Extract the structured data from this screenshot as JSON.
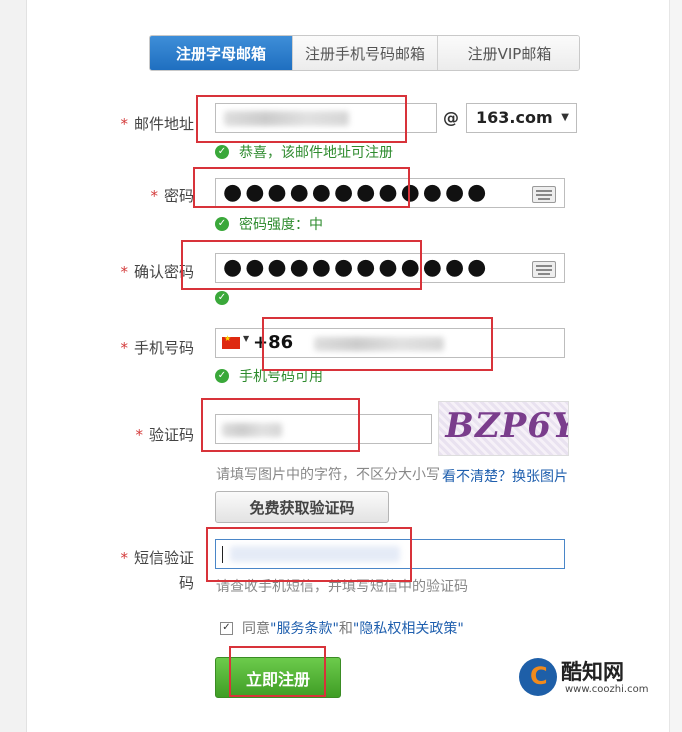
{
  "tabs": [
    "注册字母邮箱",
    "注册手机号码邮箱",
    "注册VIP邮箱"
  ],
  "required_mark": "*",
  "email": {
    "label": "邮件地址",
    "at_sign": "@",
    "domain_selected": "163.com",
    "hint": "恭喜，该邮件地址可注册"
  },
  "password": {
    "label": "密码",
    "value_mask": "●●●●●●●●●●●●",
    "hint": "密码强度：中"
  },
  "confirm_password": {
    "label": "确认密码",
    "value_mask": "●●●●●●●●●●●●"
  },
  "phone": {
    "label": "手机号码",
    "country_code": "+86",
    "hint": "手机号码可用"
  },
  "captcha": {
    "label": "验证码",
    "image_text": "BZP6Y",
    "hint": "请填写图片中的字符，不区分大小写",
    "refresh_link": "看不清楚？换张图片",
    "get_code_button": "免费获取验证码"
  },
  "sms_code": {
    "label_line1": "短信验证",
    "label_line2": "码",
    "hint": "请查收手机短信，并填写短信中的验证码"
  },
  "agreement": {
    "prefix": "同意",
    "terms": "\"服务条款\"",
    "and": "和",
    "privacy": "\"隐私权相关政策\""
  },
  "submit_button": "立即注册",
  "watermark": {
    "name": "酷知网",
    "url": "www.coozhi.com"
  },
  "colors": {
    "tab_active": "#2a7bcc",
    "hint_green": "#2e8b2e",
    "required_red": "#d43c3c",
    "annotation_red": "#d8333a",
    "submit_green": "#4faf30"
  }
}
